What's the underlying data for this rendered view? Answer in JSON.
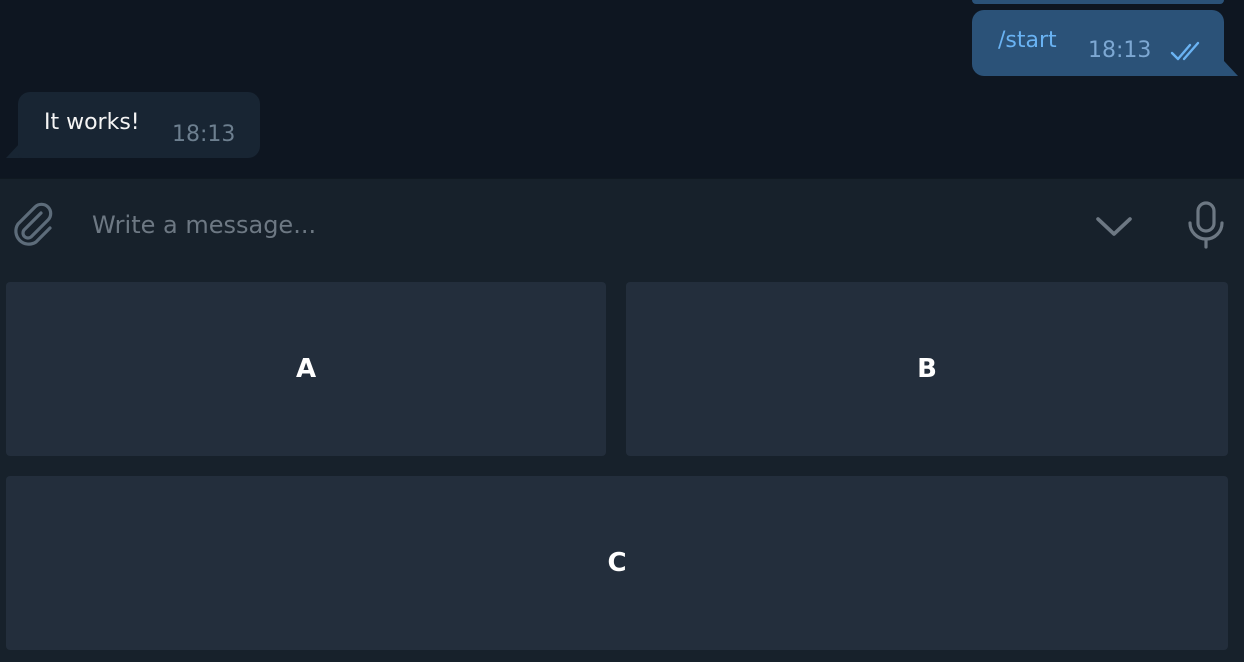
{
  "messages": {
    "outgoing": {
      "text": "/start",
      "time": "18:13",
      "status_icon": "double-check-icon"
    },
    "incoming": {
      "text": "It works!",
      "time": "18:13"
    }
  },
  "composer": {
    "placeholder": "Write a message...",
    "icons": [
      "paperclip-icon",
      "chevron-down-icon",
      "microphone-icon"
    ]
  },
  "keyboard": {
    "rows": [
      [
        {
          "label": "A"
        },
        {
          "label": "B"
        }
      ],
      [
        {
          "label": "C"
        }
      ]
    ]
  },
  "colors": {
    "chat_bg": "#0e1621",
    "panel_bg": "#17212b",
    "outgoing_bubble": "#2b5278",
    "incoming_bubble": "#182533",
    "keyboard_button": "#232e3c",
    "accent": "#6ab3f3"
  }
}
